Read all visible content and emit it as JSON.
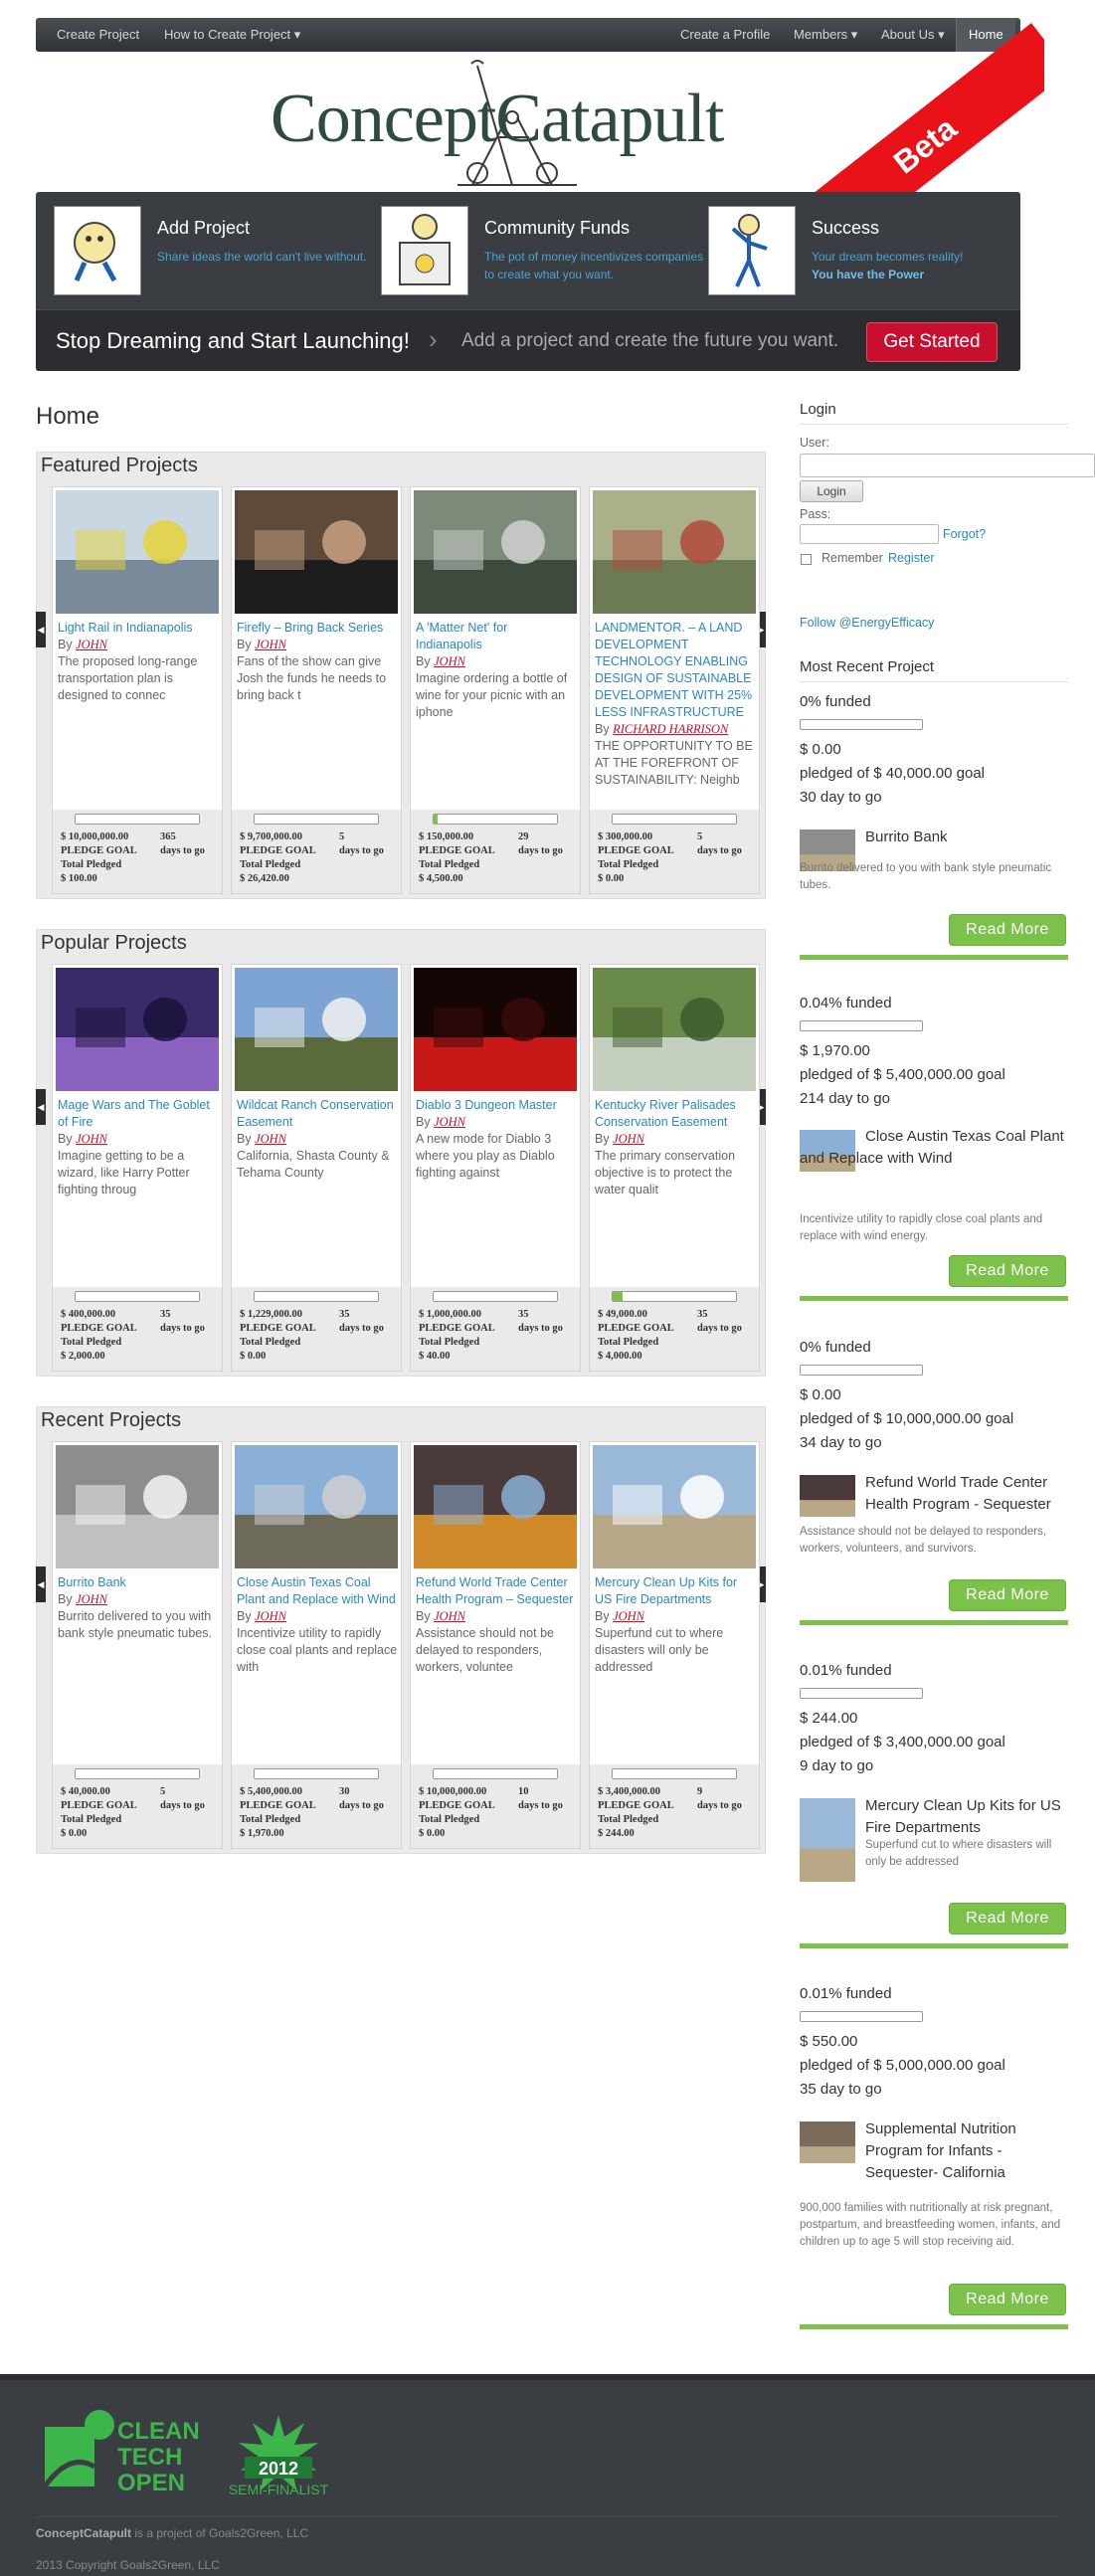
{
  "nav": {
    "left": [
      "Create Project",
      "How to Create Project ▾"
    ],
    "right": [
      "Create a Profile",
      "Members ▾",
      "About Us ▾",
      "Home"
    ]
  },
  "header": {
    "logo": "ConceptCatapult",
    "ribbon": "Beta"
  },
  "features": [
    {
      "title": "Add Project",
      "desc": "Share ideas the world can't live without.",
      "desc_bold": ""
    },
    {
      "title": "Community Funds",
      "desc": "The pot of money incentivizes companies to create what you want.",
      "desc_bold": ""
    },
    {
      "title": "Success",
      "desc": "Your dream becomes reality!",
      "desc_bold": "You have the Power"
    }
  ],
  "cta": {
    "stop": "Stop Dreaming and Start Launching!",
    "add": "Add a project and create the future you want.",
    "button": "Get Started"
  },
  "page_title": "Home",
  "stat_labels": {
    "goal": "PLEDGE GOAL",
    "days": "days to go",
    "pledged": "Total Pledged",
    "by": "By"
  },
  "sections": [
    {
      "title": "Featured Projects",
      "projects": [
        {
          "title": "Light Rail in Indianapolis",
          "author": "JOHN",
          "desc": "The proposed long-range transportation plan is designed to connec",
          "goal": "$ 10,000,000.00",
          "days": "365",
          "pledged": "$ 100.00",
          "progress": 0.0
        },
        {
          "title": "Firefly – Bring Back Series",
          "author": "JOHN",
          "desc": "Fans of the show can give Josh the funds he needs to bring back t",
          "goal": "$ 9,700,000.00",
          "days": "5",
          "pledged": "$ 26,420.00",
          "progress": 0.0
        },
        {
          "title": "A 'Matter Net' for Indianapolis",
          "author": "JOHN",
          "desc": "Imagine ordering a bottle of wine for your picnic with an iphone",
          "goal": "$ 150,000.00",
          "days": "29",
          "pledged": "$ 4,500.00",
          "progress": 0.03
        },
        {
          "title": "LANDMENTOR. – A LAND DEVELOPMENT TECHNOLOGY ENABLING DESIGN OF SUSTAINABLE DEVELOPMENT WITH 25% LESS INFRASTRUCTURE",
          "author": "RICHARD HARRISON",
          "desc": "THE OPPORTUNITY TO BE AT THE FOREFRONT OF SUSTAINABILITY: Neighb",
          "goal": "$ 300,000.00",
          "days": "5",
          "pledged": "$ 0.00",
          "progress": 0.0
        }
      ]
    },
    {
      "title": "Popular Projects",
      "projects": [
        {
          "title": "Mage Wars and The Goblet of Fire",
          "author": "JOHN",
          "desc": "Imagine getting to be a wizard, like Harry Potter fighting throug",
          "goal": "$ 400,000.00",
          "days": "35",
          "pledged": "$ 2,000.00",
          "progress": 0.0
        },
        {
          "title": "Wildcat Ranch Conservation Easement",
          "author": "JOHN",
          "desc": "California, Shasta County & Tehama County",
          "goal": "$ 1,229,000.00",
          "days": "35",
          "pledged": "$ 0.00",
          "progress": 0.0
        },
        {
          "title": "Diablo 3 Dungeon Master",
          "author": "JOHN",
          "desc": "A new mode for Diablo 3 where you play as Diablo fighting against",
          "goal": "$ 1,000,000.00",
          "days": "35",
          "pledged": "$ 40.00",
          "progress": 0.0
        },
        {
          "title": "Kentucky River Palisades Conservation Easement",
          "author": "JOHN",
          "desc": "The primary conservation objective is to protect the water qualit",
          "goal": "$ 49,000.00",
          "days": "35",
          "pledged": "$ 4,000.00",
          "progress": 0.08
        }
      ]
    },
    {
      "title": "Recent Projects",
      "projects": [
        {
          "title": "Burrito Bank",
          "author": "JOHN",
          "desc": "Burrito delivered to you with bank style pneumatic tubes.",
          "goal": "$ 40,000.00",
          "days": "5",
          "pledged": "$ 0.00",
          "progress": 0.0
        },
        {
          "title": "Close Austin Texas Coal Plant and Replace with Wind",
          "author": "JOHN",
          "desc": "Incentivize utility to rapidly close coal plants and replace with",
          "goal": "$ 5,400,000.00",
          "days": "30",
          "pledged": "$ 1,970.00",
          "progress": 0.0
        },
        {
          "title": "Refund World Trade Center Health Program – Sequester",
          "author": "JOHN",
          "desc": "Assistance should not be delayed to responders, workers, voluntee",
          "goal": "$ 10,000,000.00",
          "days": "10",
          "pledged": "$ 0.00",
          "progress": 0.0
        },
        {
          "title": "Mercury Clean Up Kits for US Fire Departments",
          "author": "JOHN",
          "desc": "Superfund cut to where disasters will only be addressed",
          "goal": "$ 3,400,000.00",
          "days": "9",
          "pledged": "$ 244.00",
          "progress": 0.0
        }
      ]
    }
  ],
  "login": {
    "title": "Login",
    "user_label": "User:",
    "button": "Login",
    "pass_label": "Pass:",
    "forgot": "Forgot?",
    "remember": "Remember",
    "register": "Register"
  },
  "follow": "Follow @EnergyEfficacy",
  "most_recent": {
    "title": "Most Recent Project",
    "read_more": "Read More",
    "items": [
      {
        "funded": "0% funded",
        "amount": "$ 0.00",
        "goal_text": "pledged of $ 40,000.00 goal",
        "days_text": "30 day to go",
        "title": "Burrito Bank",
        "desc": "Burrito delivered to you with bank style pneumatic tubes."
      },
      {
        "funded": "0.04% funded",
        "amount": "$ 1,970.00",
        "goal_text": "pledged of $ 5,400,000.00 goal",
        "days_text": "214 day to go",
        "title": "Close Austin Texas Coal Plant and Replace with Wind",
        "desc": "Incentivize utility to rapidly close coal plants and replace with wind energy."
      },
      {
        "funded": "0% funded",
        "amount": "$ 0.00",
        "goal_text": "pledged of $ 10,000,000.00 goal",
        "days_text": "34 day to go",
        "title": "Refund World Trade Center Health Program - Sequester",
        "desc": "Assistance should not be delayed to responders, workers, volunteers, and survivors."
      },
      {
        "funded": "0.01% funded",
        "amount": "$ 244.00",
        "goal_text": "pledged of $ 3,400,000.00 goal",
        "days_text": "9 day to go",
        "title": "Mercury Clean Up Kits for US Fire Departments",
        "desc": "Superfund cut to where disasters will only be addressed"
      },
      {
        "funded": "0.01% funded",
        "amount": "$ 550.00",
        "goal_text": "pledged of $ 5,000,000.00 goal",
        "days_text": "35 day to go",
        "title": "Supplemental Nutrition Program for Infants -Sequester- California",
        "desc": "900,000 families with nutritionally at risk pregnant, postpartum, and breastfeeding women, infants, and children up to age 5 will stop receiving aid."
      }
    ]
  },
  "footer": {
    "badge_line1": "CLEAN",
    "badge_line2": "TECH",
    "badge_line3": "OPEN",
    "badge_year": "2012",
    "badge_semi": "SEMI-FINALIST",
    "brand": "ConceptCatapult",
    "project_of": " is a project of Goals2Green, LLC",
    "copyright": "2013 Copyright Goals2Green, LLC"
  },
  "colors": {
    "accent_green": "#7cc14a",
    "cta_red": "#c8102e",
    "link_blue": "#2a87c4"
  }
}
